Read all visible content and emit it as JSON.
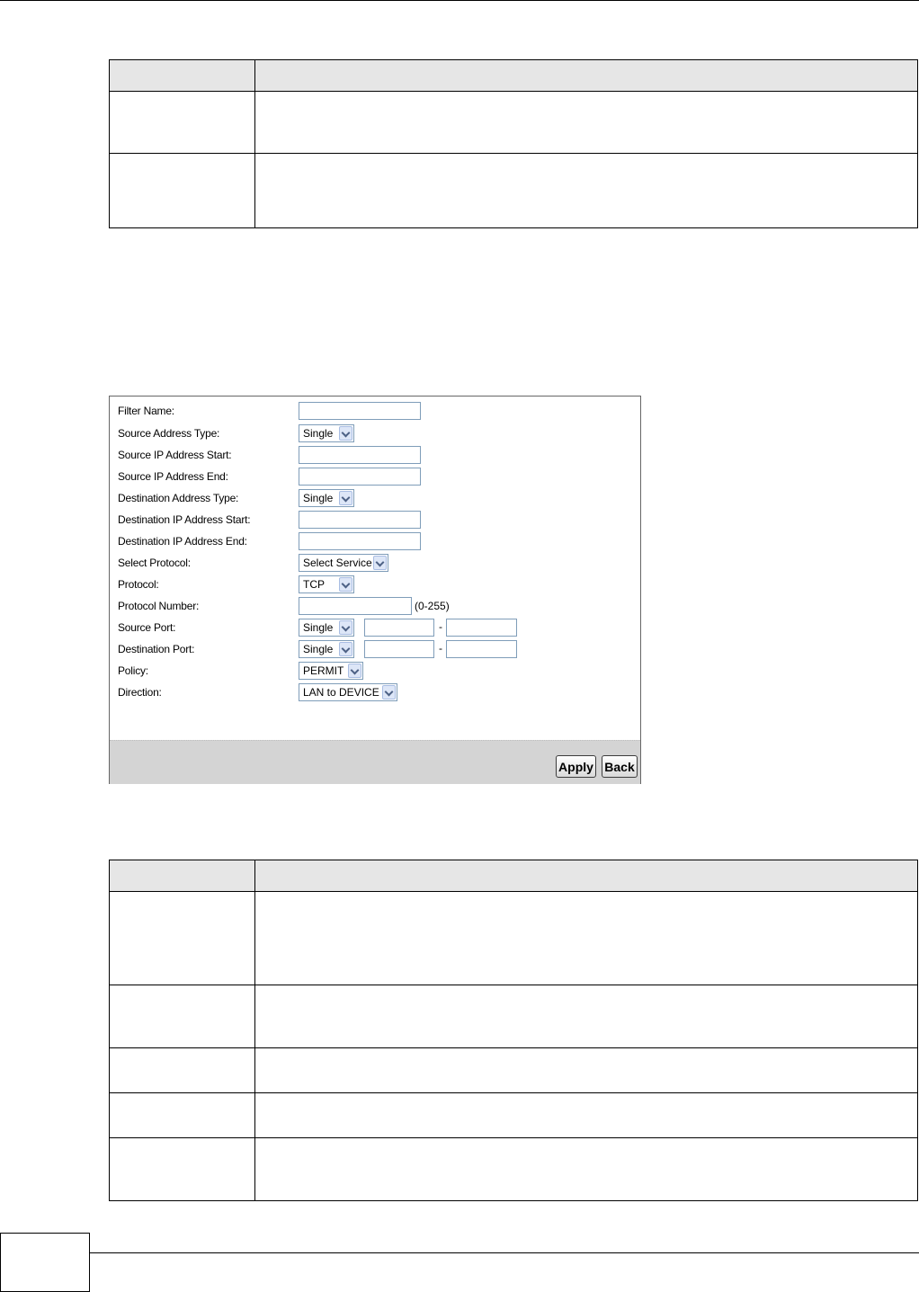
{
  "form": {
    "labels": {
      "filter_name": "Filter Name:",
      "source_address_type": "Source Address Type:",
      "source_ip_start": "Source IP Address Start:",
      "source_ip_end": "Source IP Address End:",
      "destination_address_type": "Destination Address Type:",
      "destination_ip_start": "Destination IP Address Start:",
      "destination_ip_end": "Destination IP Address End:",
      "select_protocol": "Select Protocol:",
      "protocol": "Protocol:",
      "protocol_number": "Protocol Number:",
      "source_port": "Source Port:",
      "destination_port": "Destination Port:",
      "policy": "Policy:",
      "direction": "Direction:"
    },
    "values": {
      "source_address_type": "Single",
      "destination_address_type": "Single",
      "select_protocol": "Select Service",
      "protocol": "TCP",
      "protocol_number_hint": "(0-255)",
      "source_port_type": "Single",
      "destination_port_type": "Single",
      "port_separator": "-",
      "policy": "PERMIT",
      "direction": "LAN to DEVICE"
    },
    "buttons": {
      "apply": "Apply",
      "back": "Back"
    }
  },
  "icons": {
    "dropdown": "chevron-down-icon"
  }
}
